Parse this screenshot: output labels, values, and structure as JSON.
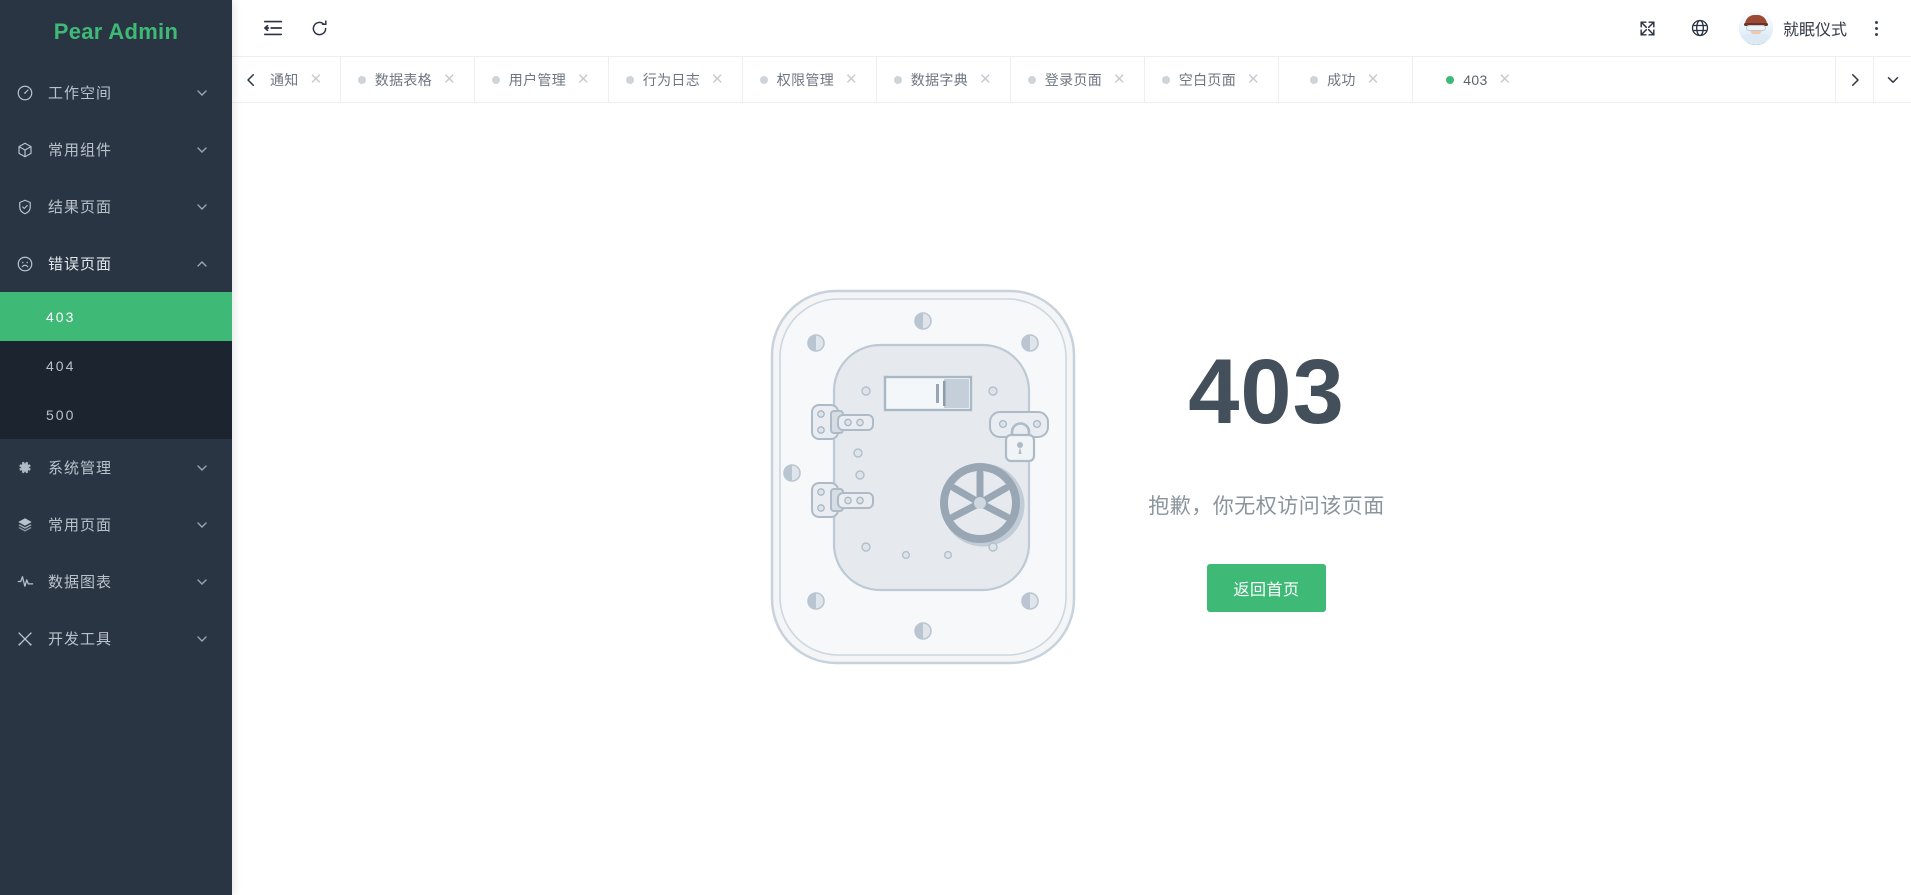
{
  "brand": {
    "title": "Pear Admin"
  },
  "sidebar": {
    "items": [
      {
        "label": "工作空间",
        "icon": "dashboard-icon",
        "expanded": false
      },
      {
        "label": "常用组件",
        "icon": "cube-icon",
        "expanded": false
      },
      {
        "label": "结果页面",
        "icon": "shield-check-icon",
        "expanded": false
      },
      {
        "label": "错误页面",
        "icon": "sad-face-icon",
        "expanded": true,
        "children": [
          {
            "label": "403",
            "active": true
          },
          {
            "label": "404",
            "active": false
          },
          {
            "label": "500",
            "active": false
          }
        ]
      },
      {
        "label": "系统管理",
        "icon": "gear-icon",
        "expanded": false
      },
      {
        "label": "常用页面",
        "icon": "layers-icon",
        "expanded": false
      },
      {
        "label": "数据图表",
        "icon": "pulse-icon",
        "expanded": false
      },
      {
        "label": "开发工具",
        "icon": "tools-icon",
        "expanded": false
      }
    ]
  },
  "header": {
    "collapse_icon": "menu-collapse-icon",
    "refresh_icon": "refresh-icon",
    "fullscreen_icon": "fullscreen-icon",
    "globe_icon": "globe-icon",
    "avatar_icon": "avatar",
    "username": "就眠仪式",
    "more_icon": "more-vertical-icon"
  },
  "tabs": {
    "prev_icon": "chevron-left-icon",
    "next_icon": "chevron-right-icon",
    "dropdown_icon": "chevron-down-icon",
    "close_glyph": "✕",
    "items": [
      {
        "label": "通知",
        "active": false,
        "clipped": true
      },
      {
        "label": "数据表格",
        "active": false
      },
      {
        "label": "用户管理",
        "active": false
      },
      {
        "label": "行为日志",
        "active": false
      },
      {
        "label": "权限管理",
        "active": false
      },
      {
        "label": "数据字典",
        "active": false
      },
      {
        "label": "登录页面",
        "active": false
      },
      {
        "label": "空白页面",
        "active": false
      },
      {
        "label": "成功",
        "active": false
      },
      {
        "label": "403",
        "active": true
      }
    ]
  },
  "content": {
    "illustration": "vault-door-illustration",
    "code": "403",
    "description": "抱歉，你无权访问该页面",
    "button_label": "返回首页"
  },
  "colors": {
    "accent": "#3FB976",
    "sidebar_bg": "#293543",
    "submenu_bg": "#1b242f",
    "code_text": "#434f5a",
    "desc_text": "#8a949d"
  }
}
